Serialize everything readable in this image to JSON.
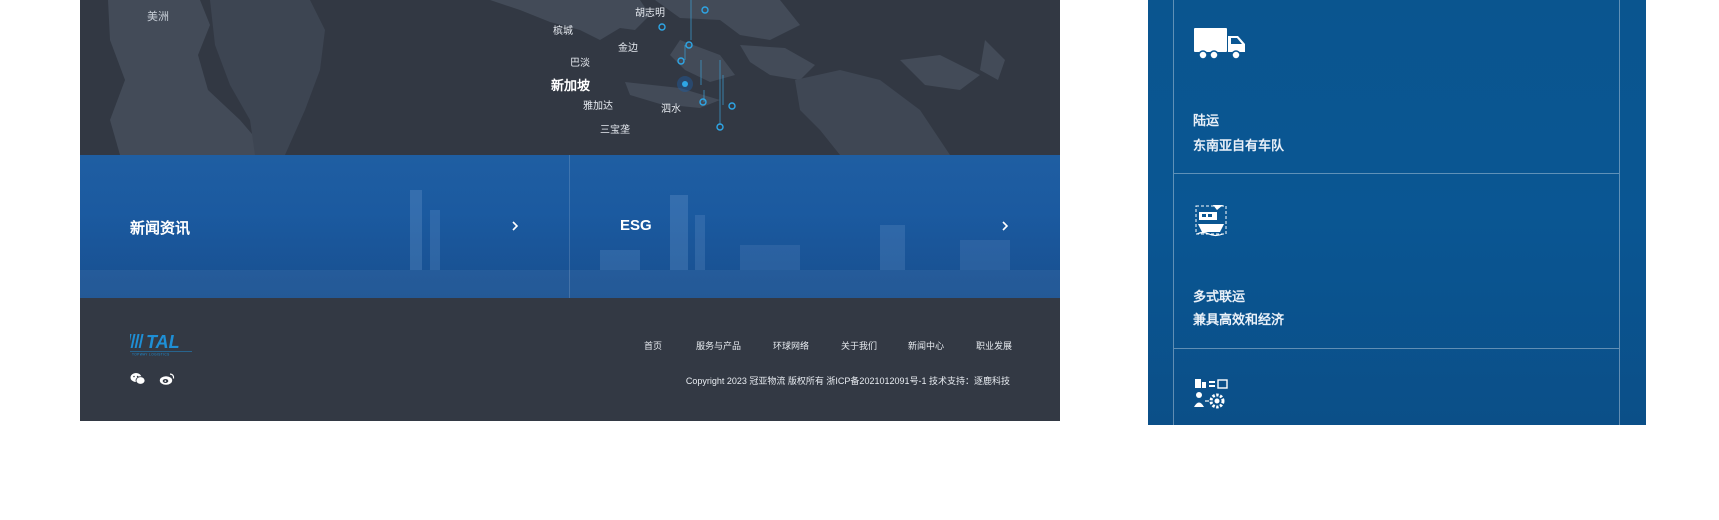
{
  "map": {
    "continent_label": "美洲",
    "cities": {
      "hochiminh": "胡志明",
      "penang": "槟城",
      "kampar": "金边",
      "batam": "巴淡",
      "singapore": "新加坡",
      "jakarta": "雅加达",
      "surabaya": "泗水",
      "semarang": "三宝垄"
    },
    "accent_color": "#1fa3e0"
  },
  "cards": {
    "news_label": "新闻资讯",
    "esg_label": "ESG"
  },
  "footer": {
    "nav": [
      "首页",
      "服务与产品",
      "环球网络",
      "关于我们",
      "新闻中心",
      "职业发展"
    ],
    "copyright": "Copyright 2023 冠亚物流 版权所有 浙ICP备2021012091号-1 技术支持：逐鹿科技",
    "logo_text": "TAL",
    "logo_sub": "TOPWAY LOGISTICS",
    "logo_color": "#1e8fd6"
  },
  "services": [
    {
      "title": "陆运",
      "subtitle": "东南亚自有车队",
      "icon": "truck-icon"
    },
    {
      "title": "多式联运",
      "subtitle": "兼具高效和经济",
      "icon": "multimodal-icon"
    },
    {
      "title": "",
      "subtitle": "",
      "icon": "process-gear-icon"
    }
  ]
}
